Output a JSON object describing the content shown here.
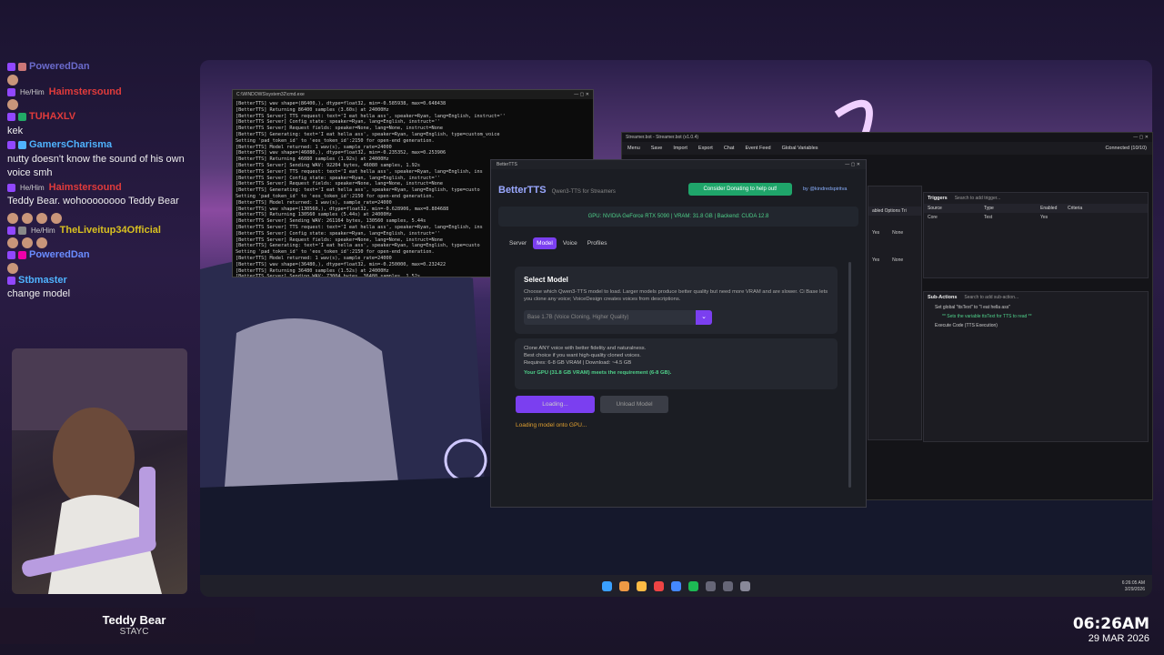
{
  "chat": [
    {
      "name": "PoweredDan",
      "color": "#6a6acb",
      "pronoun": "",
      "text": ""
    },
    {
      "name": "",
      "color": "",
      "pronoun": "",
      "text": ""
    },
    {
      "name": "Haimstersound",
      "color": "#e03b3b",
      "pronoun": "He/Him",
      "text": ""
    },
    {
      "name": "",
      "color": "",
      "pronoun": "",
      "text": ""
    },
    {
      "name": "TUHAXLV",
      "color": "#e03b3b",
      "pronoun": "",
      "text": "kek"
    },
    {
      "name": "GamersCharisma",
      "color": "#4fb3ff",
      "pronoun": "",
      "text": "nutty doesn't know the sound of his own voice smh"
    },
    {
      "name": "Haimstersound",
      "color": "#e03b3b",
      "pronoun": "He/Him",
      "text": "Teddy Bear. wohoooooooo Teddy Bear"
    },
    {
      "name": "TheLiveitup34Official",
      "color": "#d8c020",
      "pronoun": "He/Him",
      "text": ""
    },
    {
      "name": "PoweredDan",
      "color": "#6a8cff",
      "pronoun": "",
      "text": ""
    },
    {
      "name": "Stbmaster",
      "color": "#4fb3ff",
      "pronoun": "",
      "text": "change model"
    }
  ],
  "now_playing": {
    "title": "Teddy Bear",
    "artist": "STAYC"
  },
  "clock": {
    "time": "06:26AM",
    "date": "29 MAR 2026"
  },
  "terminal": {
    "title": "C:\\WINDOWS\\system32\\cmd.exe",
    "lines": [
      "[BetterTTS] wav shape=(86400,), dtype=float32, min=-0.585938, max=0.648438",
      "[BetterTTS] Returning 86400 samples (3.60s) at 24000Hz",
      "[BetterTTS Server] TTS request: text='I eat hella ass', speaker=Ryan, lang=English, instruct=''",
      "[BetterTTS Server] Config state: speaker=Ryan, lang=English, instruct=''",
      "[BetterTTS Server] Request fields: speaker=None, lang=None, instruct=None",
      "[BetterTTS] Generating: text='I eat hella ass', speaker=Ryan, lang=English, type=custom_voice",
      "Setting 'pad_token_id' to 'eos_token_id':2150 for open-end generation.",
      "[BetterTTS] Model returned: 1 wav(s), sample_rate=24000",
      "[BetterTTS] wav shape=(46080,), dtype=float32, min=-0.235352, max=0.253906",
      "[BetterTTS] Returning 46080 samples (1.92s) at 24000Hz",
      "[BetterTTS Server] Sending WAV: 92204 bytes, 46080 samples, 1.92s",
      "[BetterTTS Server] TTS request: text='I eat hella ass', speaker=Ryan, lang=English, ins",
      "[BetterTTS Server] Config state: speaker=Ryan, lang=English, instruct=''",
      "[BetterTTS Server] Request fields: speaker=None, lang=None, instruct=None",
      "[BetterTTS] Generating: text='I eat hella ass', speaker=Ryan, lang=English, type=custo",
      "Setting 'pad_token_id' to 'eos_token_id':2150 for open-end generation.",
      "[BetterTTS] Model returned: 1 wav(s), sample_rate=24000",
      "[BetterTTS] wav shape=(130560,), dtype=float32, min=-0.628906, max=0.804688",
      "[BetterTTS] Returning 130560 samples (5.44s) at 24000Hz",
      "[BetterTTS Server] Sending WAV: 261164 bytes, 130560 samples, 5.44s",
      "[BetterTTS Server] TTS request: text='I eat hella ass', speaker=Ryan, lang=English, ins",
      "[BetterTTS Server] Config state: speaker=Ryan, lang=English, instruct=''",
      "[BetterTTS Server] Request fields: speaker=None, lang=None, instruct=None",
      "[BetterTTS] Generating: text='I eat hella ass', speaker=Ryan, lang=English, type=custo",
      "Setting 'pad_token_id' to 'eos_token_id':2150 for open-end generation.",
      "[BetterTTS] Model returned: 1 wav(s), sample_rate=24000",
      "[BetterTTS] wav shape=(36480,), dtype=float32, min=-0.250000, max=0.232422",
      "[BetterTTS] Returning 36480 samples (1.52s) at 24000Hz",
      "[BetterTTS Server] Sending WAV: 73004 bytes, 36480 samples, 1.52s"
    ]
  },
  "streamerbot": {
    "title": "Streamer.bot - Streamer.bot (v1.0.4)",
    "menu": [
      "Menu",
      "Save",
      "Import",
      "Export",
      "Chat",
      "Event Feed",
      "Global Variables"
    ],
    "status": "Connected (10/10)",
    "triggers_title": "Triggers",
    "triggers_search": "Search to add trigger...",
    "trigger_cols": [
      "Source",
      "Type",
      "Enabled",
      "Criteria"
    ],
    "trigger_row": [
      "Core",
      "Test",
      "Yes",
      ""
    ],
    "left_cols": "abled Options Tri",
    "left_rows": [
      [
        "Yes",
        "None"
      ],
      [
        "Yes",
        "None"
      ]
    ],
    "subactions_title": "Sub-Actions",
    "subactions_search": "Search to add sub-action...",
    "subactions": [
      "Set global \"ttsText\" to \"I eat hella ass\"",
      "** Sets the variable ttsText for TTS to read **",
      "Execute Code (TTS Execution)"
    ]
  },
  "betterTTS": {
    "window_title": "BetterTTS",
    "logo": "BetterTTS",
    "subtitle": "Qwen3-TTS for Streamers",
    "donate": "Consider Donating to help out!",
    "byline": "by @kindredspiritva",
    "gpu": "GPU: NVIDIA GeForce RTX 5090  |  VRAM: 31.8 GB  |  Backend: CUDA 12.8",
    "tabs": [
      "Server",
      "Model",
      "Voice",
      "Profiles"
    ],
    "select_title": "Select Model",
    "select_desc": "Choose which Qwen3-TTS model to load. Larger models produce better quality but need more VRAM and are slower. Ci Base lets you clone any voice; VoiceDesign creates voices from descriptions.",
    "selected_model": "Base 1.7B  (Voice Cloning, Higher Quality)",
    "info_line1": "Clone ANY voice with better fidelity and naturalness.",
    "info_line2": "Best choice if you want high-quality cloned voices.",
    "info_line3": "Requires: 6-8 GB VRAM  |  Download: ~4.5 GB",
    "info_ok": "Your GPU (31.8 GB VRAM) meets the requirement (6-8 GB).",
    "load_btn": "Loading...",
    "unload_btn": "Unload Model",
    "status": "Loading model onto GPU..."
  },
  "tray": {
    "time": "6:26:05 AM",
    "date": "3/29/2026",
    "temp": "66"
  }
}
